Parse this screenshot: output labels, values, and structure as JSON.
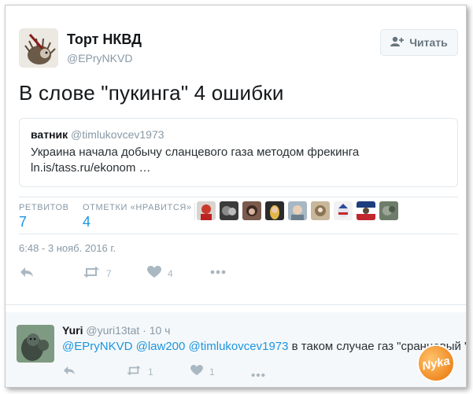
{
  "tweet": {
    "author_name": "Торт НКВД",
    "author_handle": "@EPryNKVD",
    "follow_label": "Читать",
    "text": "В слове \"пукинга\" 4 ошибки",
    "quote": {
      "name": "ватник",
      "handle": "@timlukovcev1973",
      "text": "Украина начала добычу сланцевого газа методом фрекинга ln.is/tass.ru/ekonom …"
    },
    "stats": {
      "retweets_label": "РЕТВИТОВ",
      "retweets": "7",
      "likes_label": "ОТМЕТКИ «НРАВИТСЯ»",
      "likes": "4"
    },
    "timestamp": "6:48 - 3 нояб. 2016 г.",
    "actions": {
      "retweet_count": "7",
      "like_count": "4"
    }
  },
  "reply": {
    "name": "Yuri",
    "handle": "@yuri13tat",
    "time": "· 10 ч",
    "mentions": [
      "@EPryNKVD",
      "@law200",
      "@timlukovcev1973"
    ],
    "text": "в таком случае газ \"сранцевый \"",
    "retweet_count": "1",
    "like_count": "1"
  },
  "badge_text": "Nyka",
  "colors": {
    "link": "#1b95e0",
    "muted": "#8899a6",
    "icon": "#aab8c2"
  }
}
